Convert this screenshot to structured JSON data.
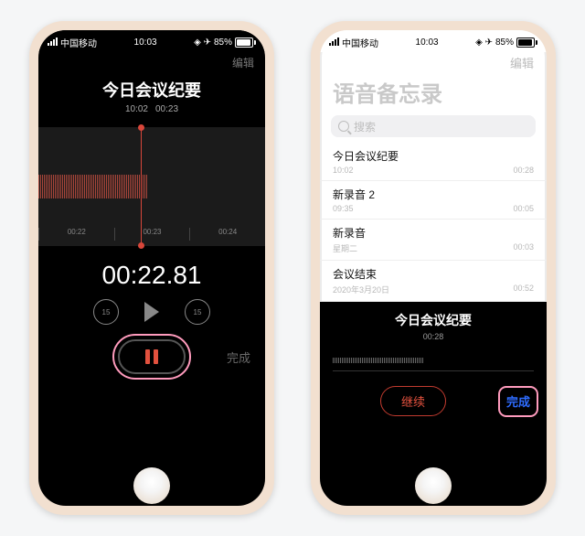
{
  "status": {
    "carrier": "中国移动",
    "time": "10:03",
    "battery_pct": "85%"
  },
  "left": {
    "edit": "编辑",
    "title": "今日会议纪要",
    "subtitle_time": "10:02",
    "subtitle_dur": "00:23",
    "ruler": [
      "00:22",
      "00:23",
      "00:24"
    ],
    "timer": "00:22.81",
    "skip_seconds": "15",
    "done": "完成"
  },
  "right": {
    "edit": "编辑",
    "big_title": "语音备忘录",
    "search_placeholder": "搜索",
    "items": [
      {
        "title": "今日会议纪要",
        "sub": "10:02",
        "dur": "00:28"
      },
      {
        "title": "新录音 2",
        "sub": "09:35",
        "dur": "00:05"
      },
      {
        "title": "新录音",
        "sub": "星期二",
        "dur": "00:03"
      },
      {
        "title": "会议结束",
        "sub": "2020年3月20日",
        "dur": "00:52"
      }
    ],
    "panel": {
      "title": "今日会议纪要",
      "dur": "00:28",
      "continue": "继续",
      "done": "完成"
    }
  }
}
